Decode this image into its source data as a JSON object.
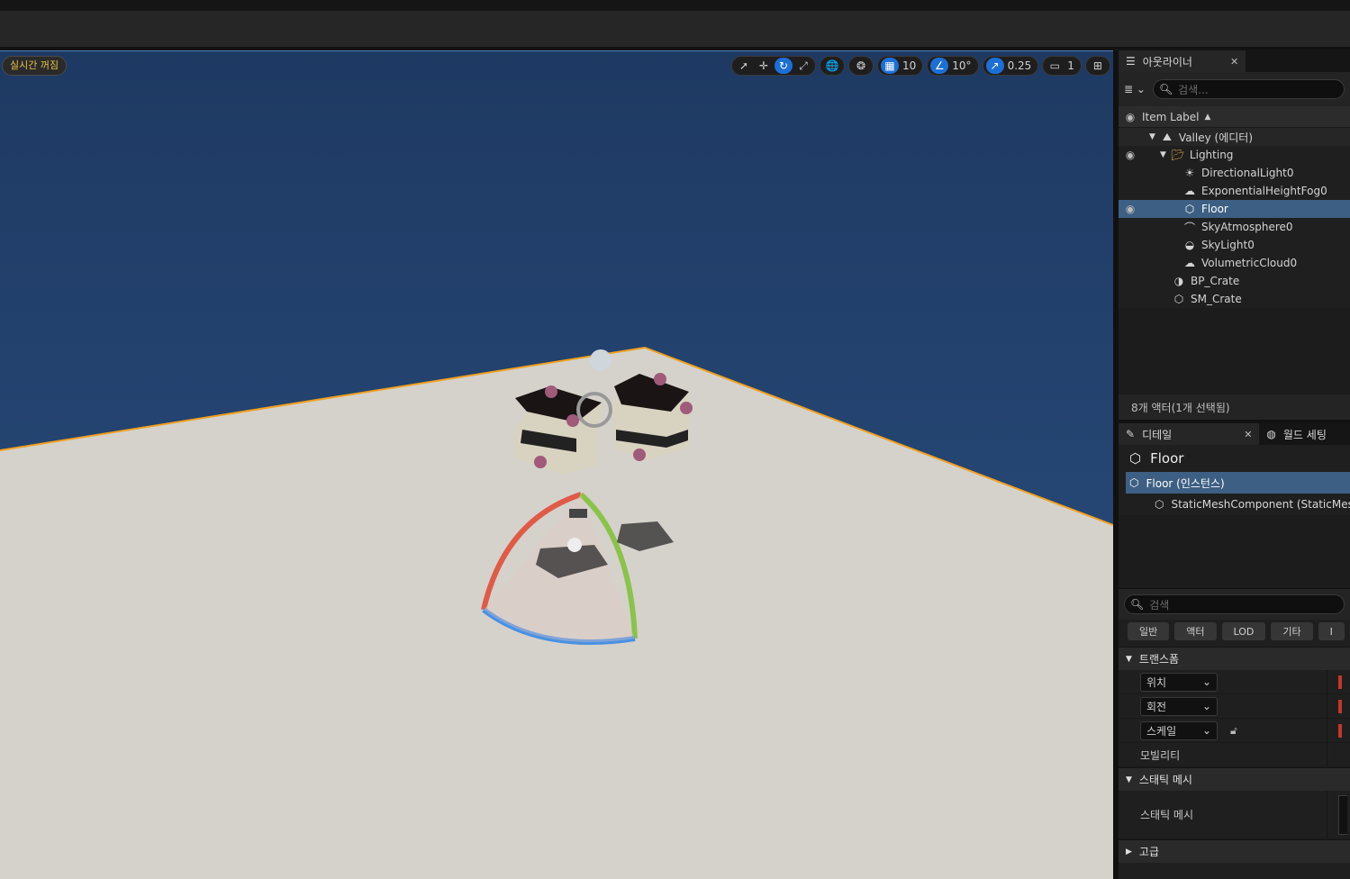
{
  "viewport": {
    "realtime_label": "실시간 꺼짐",
    "grid_snap": "10",
    "rotation_snap": "10°",
    "scale_snap": "0.25",
    "camera_speed": "1"
  },
  "outliner": {
    "tab_label": "아웃라이너",
    "search_placeholder": "검색...",
    "column_label": "Item Label",
    "items": [
      {
        "label": "Valley (에디터)",
        "icon": "level-icon"
      },
      {
        "label": "Lighting",
        "icon": "folder-icon"
      },
      {
        "label": "DirectionalLight0",
        "icon": "directional-light-icon"
      },
      {
        "label": "ExponentialHeightFog0",
        "icon": "fog-icon"
      },
      {
        "label": "Floor",
        "icon": "static-mesh-icon"
      },
      {
        "label": "SkyAtmosphere0",
        "icon": "sky-atmosphere-icon"
      },
      {
        "label": "SkyLight0",
        "icon": "sky-light-icon"
      },
      {
        "label": "VolumetricCloud0",
        "icon": "cloud-icon"
      },
      {
        "label": "BP_Crate",
        "icon": "blueprint-icon"
      },
      {
        "label": "SM_Crate",
        "icon": "static-mesh-icon"
      }
    ],
    "status": "8개 액터(1개 선택됨)"
  },
  "details": {
    "tab_label": "디테일",
    "world_settings_label": "월드 세팅",
    "selected_name": "Floor",
    "components": [
      {
        "label": "Floor (인스턴스)"
      },
      {
        "label": "StaticMeshComponent (StaticMes"
      }
    ],
    "search_placeholder": "검색",
    "filters": [
      "일반",
      "액터",
      "LOD",
      "기타",
      "I"
    ],
    "sections": {
      "transform": "트랜스폼",
      "static_mesh": "스태틱 메시",
      "advanced": "고급"
    },
    "props": {
      "location": "위치",
      "rotation": "회전",
      "scale": "스케일",
      "mobility": "모빌리티",
      "static_mesh": "스태틱 메시"
    }
  }
}
